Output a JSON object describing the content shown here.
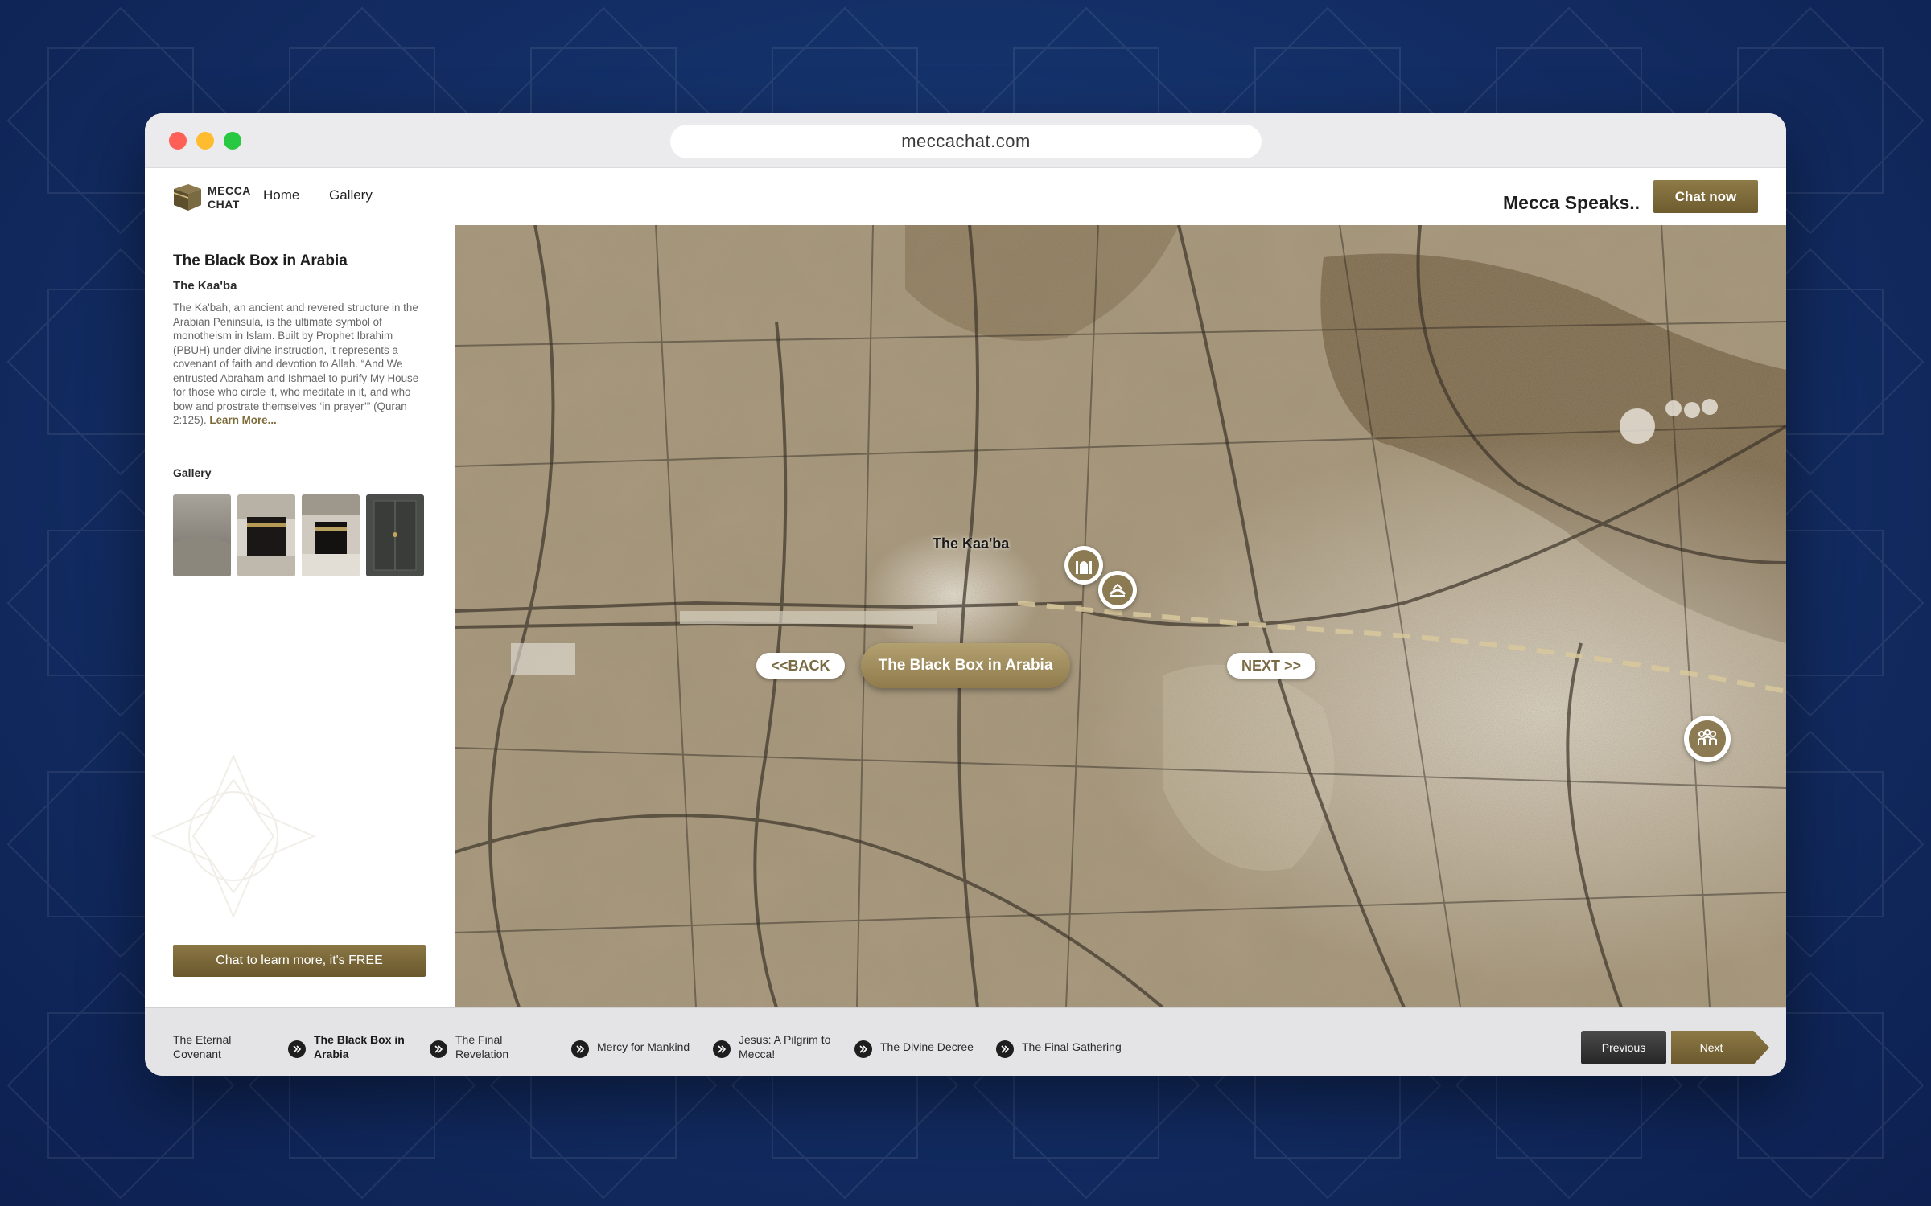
{
  "browser": {
    "url": "meccachat.com"
  },
  "header": {
    "logo_line1": "MECCA",
    "logo_line2": "CHAT",
    "nav": [
      {
        "label": "Home"
      },
      {
        "label": "Gallery"
      }
    ],
    "tagline": "Mecca Speaks..",
    "chat_button": "Chat now"
  },
  "sidebar": {
    "title": "The Black Box in Arabia",
    "subtitle": "The Kaa'ba",
    "body": "The Ka'bah, an ancient and revered structure in the Arabian Peninsula, is the ultimate symbol of monotheism in Islam. Built by Prophet Ibrahim (PBUH) under divine instruction, it represents a covenant of faith and devotion to Allah. “And We entrusted Abraham and Ishmael to purify My House for those who circle it, who meditate in it, and who bow and prostrate themselves ‘in prayer’” (Quran 2:125). ",
    "learn_more": "Learn More...",
    "gallery_label": "Gallery",
    "cta": "Chat to learn more, it's FREE"
  },
  "map": {
    "kaaba_label": "The Kaa'ba",
    "back": "<<BACK",
    "title": "The Black Box in Arabia",
    "next": "NEXT >>"
  },
  "chapters": [
    {
      "label": "The Eternal Covenant",
      "active": false
    },
    {
      "label": "The Black Box in Arabia",
      "active": true
    },
    {
      "label": "The Final Revelation",
      "active": false
    },
    {
      "label": "Mercy for Mankind",
      "active": false
    },
    {
      "label": "Jesus: A Pilgrim to Mecca!",
      "active": false
    },
    {
      "label": "The Divine Decree",
      "active": false
    },
    {
      "label": "The Final Gathering",
      "active": false
    }
  ],
  "pager": {
    "previous": "Previous",
    "next": "Next"
  },
  "colors": {
    "gold": "#8b7745",
    "dark": "#1e1e1e",
    "background": "#143068"
  }
}
